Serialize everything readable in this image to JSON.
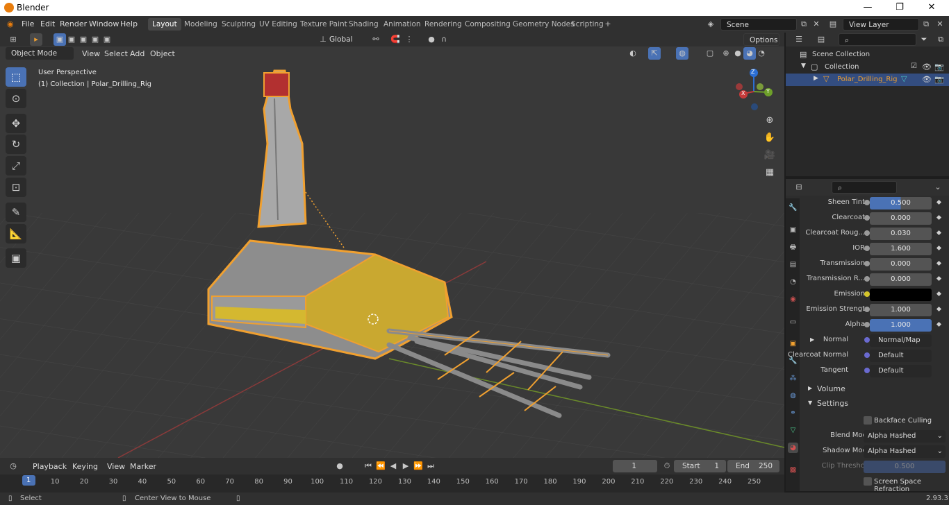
{
  "app": {
    "title": "Blender",
    "version": "2.93.3"
  },
  "menus": [
    "File",
    "Edit",
    "Render",
    "Window",
    "Help"
  ],
  "workspaces": [
    "Layout",
    "Modeling",
    "Sculpting",
    "UV Editing",
    "Texture Paint",
    "Shading",
    "Animation",
    "Rendering",
    "Compositing",
    "Geometry Nodes",
    "Scripting"
  ],
  "active_workspace": "Layout",
  "scene": {
    "name": "Scene",
    "view_layer": "View Layer"
  },
  "viewport": {
    "transform_orientation": "Global",
    "options_label": "Options",
    "mode": "Object Mode",
    "header_menus": [
      "View",
      "Select",
      "Add",
      "Object"
    ],
    "overlay_perspective": "User Perspective",
    "overlay_collection": "(1) Collection | Polar_Drilling_Rig",
    "gizmo_labels": {
      "x": "X",
      "y": "Y",
      "z": "Z"
    }
  },
  "outliner": {
    "root": "Scene Collection",
    "collection": "Collection",
    "object": "Polar_Drilling_Rig"
  },
  "properties": {
    "rows": [
      {
        "label": "Sheen Tint",
        "value": "0.500",
        "style": "blue",
        "fill": 0.5
      },
      {
        "label": "Clearcoat",
        "value": "0.000",
        "style": "plain"
      },
      {
        "label": "Clearcoat Roug...",
        "value": "0.030",
        "style": "plain"
      },
      {
        "label": "IOR",
        "value": "1.600",
        "style": "plain"
      },
      {
        "label": "Transmission",
        "value": "0.000",
        "style": "plain"
      },
      {
        "label": "Transmission R...",
        "value": "0.000",
        "style": "plain"
      },
      {
        "label": "Emission",
        "value": "",
        "style": "color"
      },
      {
        "label": "Emission Strengt",
        "value": "1.000",
        "style": "plain"
      },
      {
        "label": "Alpha",
        "value": "1.000",
        "style": "blue",
        "fill": 1.0
      },
      {
        "label": "Normal",
        "value": "Normal/Map",
        "style": "slot"
      },
      {
        "label": "Clearcoat Normal",
        "value": "Default",
        "style": "slot"
      },
      {
        "label": "Tangent",
        "value": "Default",
        "style": "slot"
      }
    ],
    "panel_volume": "Volume",
    "panel_settings": "Settings",
    "backface_culling": "Backface Culling",
    "blend_mode_label": "Blend Mode",
    "blend_mode_value": "Alpha Hashed",
    "shadow_mode_label": "Shadow Mode",
    "shadow_mode_value": "Alpha Hashed",
    "clip_threshold_label": "Clip Threshold",
    "clip_threshold_value": "0.500",
    "ssr_label": "Screen Space Refraction"
  },
  "timeline": {
    "menus": [
      "Playback",
      "Keying",
      "View",
      "Marker"
    ],
    "current_frame": "1",
    "start_label": "Start",
    "start": "1",
    "end_label": "End",
    "end": "250",
    "ticks": [
      "1",
      "10",
      "20",
      "30",
      "40",
      "50",
      "60",
      "70",
      "80",
      "90",
      "100",
      "110",
      "120",
      "130",
      "140",
      "150",
      "160",
      "170",
      "180",
      "190",
      "200",
      "210",
      "220",
      "230",
      "240",
      "250"
    ]
  },
  "statusbar": {
    "select": "Select",
    "center": "Center View to Mouse"
  },
  "colors": {
    "accent_blue": "#4a72b5",
    "selection_orange": "#f0a030",
    "header_bg": "#303030"
  }
}
